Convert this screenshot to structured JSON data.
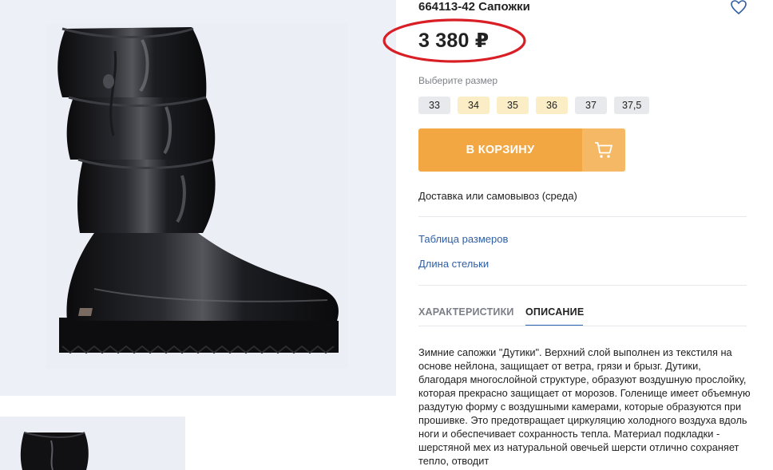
{
  "product": {
    "title": "664113-42 Сапожки",
    "price": "3 380 ₽"
  },
  "sizes": {
    "label": "Выберите размер",
    "items": [
      {
        "value": "33",
        "available": false
      },
      {
        "value": "34",
        "available": true
      },
      {
        "value": "35",
        "available": true
      },
      {
        "value": "36",
        "available": true
      },
      {
        "value": "37",
        "available": false
      },
      {
        "value": "37,5",
        "available": false
      }
    ]
  },
  "cart": {
    "label": "В КОРЗИНУ"
  },
  "delivery": {
    "text": "Доставка или самовывоз (среда)"
  },
  "links": {
    "size_table": "Таблица размеров",
    "insole_length": "Длина стельки"
  },
  "tabs": {
    "characteristics": "ХАРАКТЕРИСТИКИ",
    "description": "ОПИСАНИЕ"
  },
  "description": {
    "text": "Зимние сапожки \"Дутики\". Верхний слой выполнен из текстиля на основе нейлона, защищает от ветра, грязи и брызг. Дутики, благодаря многослойной структуре, образуют воздушную прослойку, которая прекрасно защищает от морозов. Голенище имеет объемную раздутую форму с воздушными камерами, которые образуются при прошивке. Это предотвращает циркуляцию холодного воздуха вдоль ноги и обеспечивает сохранность тепла. Материал подкладки - шерстяной мех из натуральной овечьей шерсти отлично сохраняет тепло, отводит"
  },
  "colors": {
    "accent_orange": "#f2a742",
    "link_blue": "#2f5fa3",
    "price_highlight_red": "#d81f26",
    "size_available_bg": "#fbedc6",
    "size_unavailable_bg": "#e8e9ed"
  },
  "icons": {
    "favorite": "heart-icon",
    "cart": "shopping-cart-icon"
  }
}
